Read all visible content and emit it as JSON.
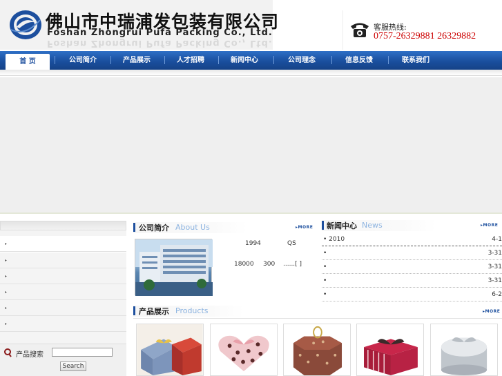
{
  "header": {
    "company_cn": "佛山市中瑞浦发包装有限公司",
    "company_en": "Foshan Zhongrui Pufa Packing Co., Ltd.",
    "hotline_label": "客服热线:",
    "hotline_number": "0757-26329881 26329882"
  },
  "nav": {
    "items": [
      "首 页",
      "公司简介",
      "产品展示",
      "人才招聘",
      "新闻中心",
      "公司理念",
      "信息反馈",
      "联系我们"
    ]
  },
  "sidebar": {
    "search_label": "产品搜索",
    "search_value": "",
    "search_button": "Search"
  },
  "about": {
    "title_cn": "公司简介",
    "title_en": "About Us",
    "more": "MORE",
    "text_1994": "1994",
    "text_qs": "QS",
    "text_18000": "18000",
    "text_300": "300",
    "text_ellipsis": "......[ ]"
  },
  "news": {
    "title_cn": "新闻中心",
    "title_en": "News",
    "more": "MORE",
    "items": [
      {
        "title": "• 2010",
        "date": "4-1"
      },
      {
        "title": "•",
        "date": "3-31"
      },
      {
        "title": "•",
        "date": "3-31"
      },
      {
        "title": "•",
        "date": "3-31"
      },
      {
        "title": "•",
        "date": "6-2"
      }
    ]
  },
  "products": {
    "title_cn": "产品展示",
    "title_en": "Products",
    "more": "MORE"
  },
  "colors": {
    "nav_blue": "#1a4f9e",
    "hotline_red": "#cc0000",
    "accent_light_blue": "#8cb3e0"
  }
}
